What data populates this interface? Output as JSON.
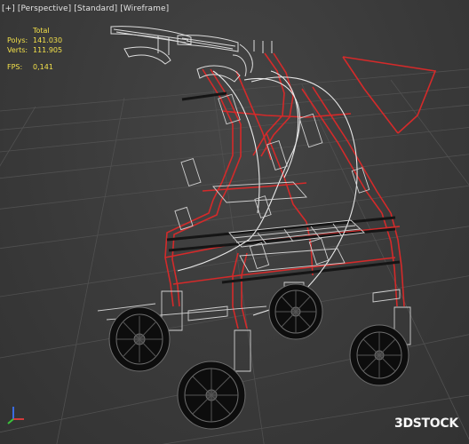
{
  "viewport": {
    "menu": "[+]",
    "view": "[Perspective]",
    "shading_mode": "[Standard]",
    "display": "[Wireframe]"
  },
  "stats": {
    "header": "Total",
    "polys_label": "Polys:",
    "polys_value": "141.030",
    "verts_label": "Verts:",
    "verts_value": "111.905",
    "fps_label": "FPS:",
    "fps_value": "0,141"
  },
  "watermark": {
    "prefix": "3D",
    "suffix": "STOCK"
  },
  "colors": {
    "background": "#393939",
    "grid": "#4f4f4f",
    "frame_red": "#d42a2a",
    "wire_white": "#e8e8e8",
    "wire_gray": "#8a8a8a",
    "stats_yellow": "#f2e04a"
  },
  "icons": [
    "axis-gizmo-icon"
  ]
}
